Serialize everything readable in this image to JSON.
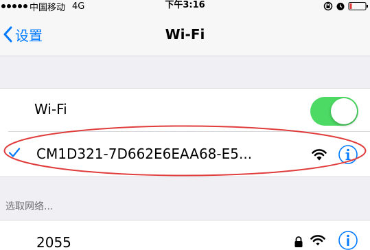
{
  "status_bar": {
    "carrier": "中国移动",
    "network_type": "4G",
    "time": "下午3:16"
  },
  "nav": {
    "back_label": "设置",
    "title": "Wi-Fi"
  },
  "wifi_toggle": {
    "label": "Wi-Fi",
    "state": "on"
  },
  "connected_network": {
    "name": "CM1D321-7D662E6EAA68-E5...",
    "icons": [
      "checkmark-icon",
      "wifi-strength-icon",
      "info-icon"
    ]
  },
  "networks_section": {
    "header": "选取网络...",
    "items": [
      {
        "name": "2055",
        "icons": [
          "lock-icon",
          "wifi-strength-icon",
          "info-icon"
        ]
      }
    ]
  },
  "colors": {
    "accent": "#007aff",
    "toggle_on": "#4cd964",
    "annotation": "#e03c3c",
    "background": "#efeff4"
  }
}
